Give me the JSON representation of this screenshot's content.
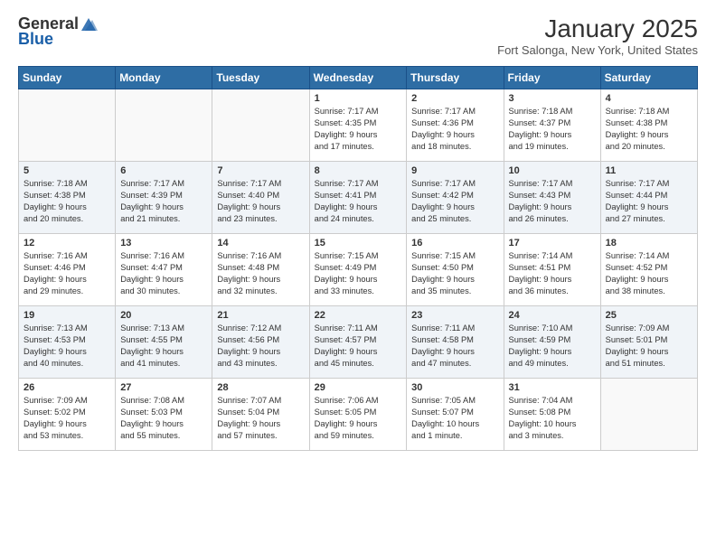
{
  "header": {
    "logo_general": "General",
    "logo_blue": "Blue",
    "title": "January 2025",
    "location": "Fort Salonga, New York, United States"
  },
  "weekdays": [
    "Sunday",
    "Monday",
    "Tuesday",
    "Wednesday",
    "Thursday",
    "Friday",
    "Saturday"
  ],
  "weeks": [
    [
      {
        "day": "",
        "info": ""
      },
      {
        "day": "",
        "info": ""
      },
      {
        "day": "",
        "info": ""
      },
      {
        "day": "1",
        "info": "Sunrise: 7:17 AM\nSunset: 4:35 PM\nDaylight: 9 hours\nand 17 minutes."
      },
      {
        "day": "2",
        "info": "Sunrise: 7:17 AM\nSunset: 4:36 PM\nDaylight: 9 hours\nand 18 minutes."
      },
      {
        "day": "3",
        "info": "Sunrise: 7:18 AM\nSunset: 4:37 PM\nDaylight: 9 hours\nand 19 minutes."
      },
      {
        "day": "4",
        "info": "Sunrise: 7:18 AM\nSunset: 4:38 PM\nDaylight: 9 hours\nand 20 minutes."
      }
    ],
    [
      {
        "day": "5",
        "info": "Sunrise: 7:18 AM\nSunset: 4:38 PM\nDaylight: 9 hours\nand 20 minutes."
      },
      {
        "day": "6",
        "info": "Sunrise: 7:17 AM\nSunset: 4:39 PM\nDaylight: 9 hours\nand 21 minutes."
      },
      {
        "day": "7",
        "info": "Sunrise: 7:17 AM\nSunset: 4:40 PM\nDaylight: 9 hours\nand 23 minutes."
      },
      {
        "day": "8",
        "info": "Sunrise: 7:17 AM\nSunset: 4:41 PM\nDaylight: 9 hours\nand 24 minutes."
      },
      {
        "day": "9",
        "info": "Sunrise: 7:17 AM\nSunset: 4:42 PM\nDaylight: 9 hours\nand 25 minutes."
      },
      {
        "day": "10",
        "info": "Sunrise: 7:17 AM\nSunset: 4:43 PM\nDaylight: 9 hours\nand 26 minutes."
      },
      {
        "day": "11",
        "info": "Sunrise: 7:17 AM\nSunset: 4:44 PM\nDaylight: 9 hours\nand 27 minutes."
      }
    ],
    [
      {
        "day": "12",
        "info": "Sunrise: 7:16 AM\nSunset: 4:46 PM\nDaylight: 9 hours\nand 29 minutes."
      },
      {
        "day": "13",
        "info": "Sunrise: 7:16 AM\nSunset: 4:47 PM\nDaylight: 9 hours\nand 30 minutes."
      },
      {
        "day": "14",
        "info": "Sunrise: 7:16 AM\nSunset: 4:48 PM\nDaylight: 9 hours\nand 32 minutes."
      },
      {
        "day": "15",
        "info": "Sunrise: 7:15 AM\nSunset: 4:49 PM\nDaylight: 9 hours\nand 33 minutes."
      },
      {
        "day": "16",
        "info": "Sunrise: 7:15 AM\nSunset: 4:50 PM\nDaylight: 9 hours\nand 35 minutes."
      },
      {
        "day": "17",
        "info": "Sunrise: 7:14 AM\nSunset: 4:51 PM\nDaylight: 9 hours\nand 36 minutes."
      },
      {
        "day": "18",
        "info": "Sunrise: 7:14 AM\nSunset: 4:52 PM\nDaylight: 9 hours\nand 38 minutes."
      }
    ],
    [
      {
        "day": "19",
        "info": "Sunrise: 7:13 AM\nSunset: 4:53 PM\nDaylight: 9 hours\nand 40 minutes."
      },
      {
        "day": "20",
        "info": "Sunrise: 7:13 AM\nSunset: 4:55 PM\nDaylight: 9 hours\nand 41 minutes."
      },
      {
        "day": "21",
        "info": "Sunrise: 7:12 AM\nSunset: 4:56 PM\nDaylight: 9 hours\nand 43 minutes."
      },
      {
        "day": "22",
        "info": "Sunrise: 7:11 AM\nSunset: 4:57 PM\nDaylight: 9 hours\nand 45 minutes."
      },
      {
        "day": "23",
        "info": "Sunrise: 7:11 AM\nSunset: 4:58 PM\nDaylight: 9 hours\nand 47 minutes."
      },
      {
        "day": "24",
        "info": "Sunrise: 7:10 AM\nSunset: 4:59 PM\nDaylight: 9 hours\nand 49 minutes."
      },
      {
        "day": "25",
        "info": "Sunrise: 7:09 AM\nSunset: 5:01 PM\nDaylight: 9 hours\nand 51 minutes."
      }
    ],
    [
      {
        "day": "26",
        "info": "Sunrise: 7:09 AM\nSunset: 5:02 PM\nDaylight: 9 hours\nand 53 minutes."
      },
      {
        "day": "27",
        "info": "Sunrise: 7:08 AM\nSunset: 5:03 PM\nDaylight: 9 hours\nand 55 minutes."
      },
      {
        "day": "28",
        "info": "Sunrise: 7:07 AM\nSunset: 5:04 PM\nDaylight: 9 hours\nand 57 minutes."
      },
      {
        "day": "29",
        "info": "Sunrise: 7:06 AM\nSunset: 5:05 PM\nDaylight: 9 hours\nand 59 minutes."
      },
      {
        "day": "30",
        "info": "Sunrise: 7:05 AM\nSunset: 5:07 PM\nDaylight: 10 hours\nand 1 minute."
      },
      {
        "day": "31",
        "info": "Sunrise: 7:04 AM\nSunset: 5:08 PM\nDaylight: 10 hours\nand 3 minutes."
      },
      {
        "day": "",
        "info": ""
      }
    ]
  ]
}
